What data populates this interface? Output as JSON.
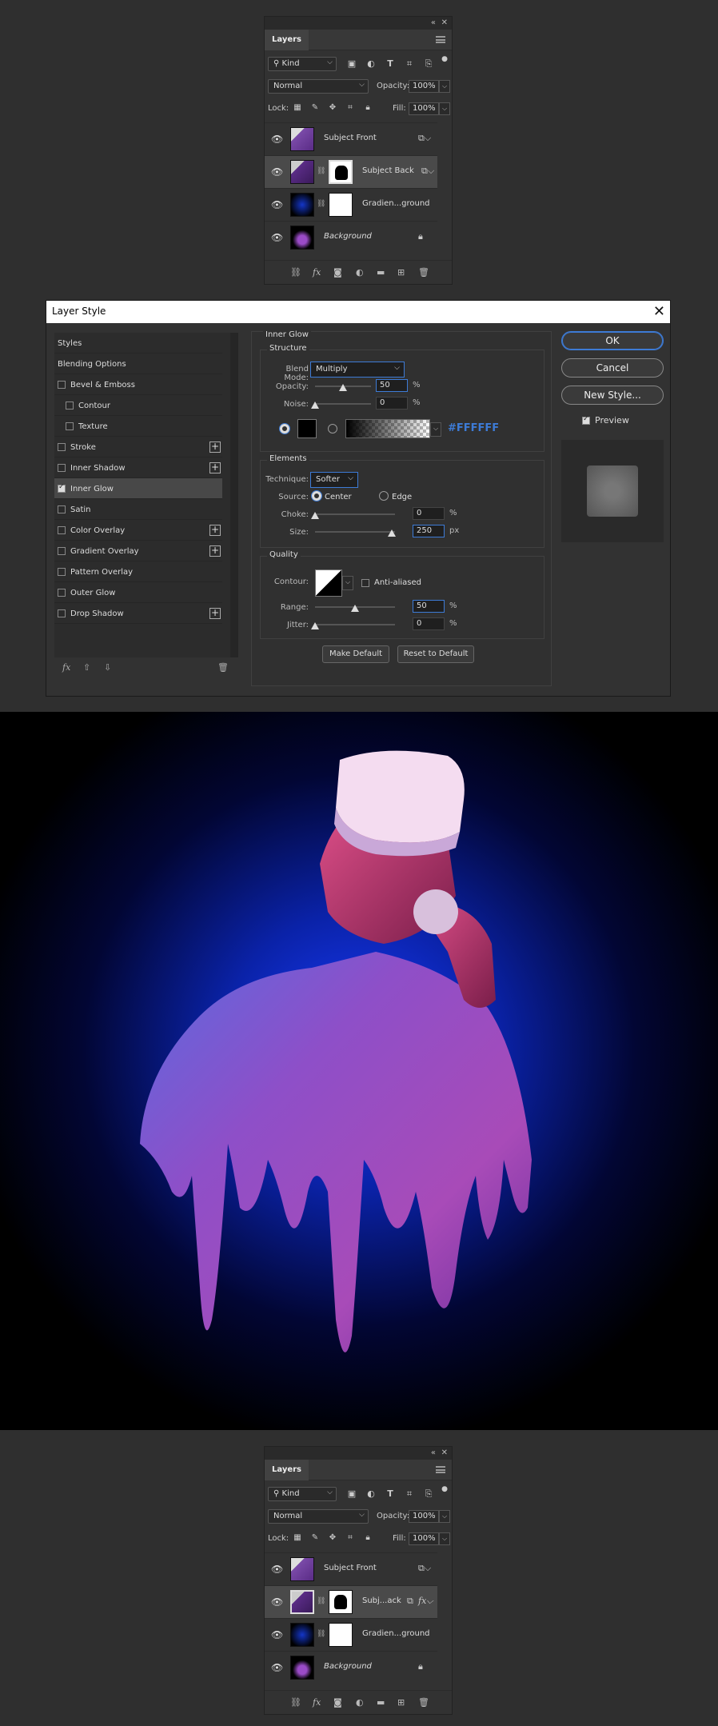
{
  "layers_panel": {
    "tab_label": "Layers",
    "filter_kind": "Kind",
    "blend_mode": "Normal",
    "opacity_label": "Opacity:",
    "opacity_value": "100%",
    "lock_label": "Lock:",
    "fill_label": "Fill:",
    "fill_value": "100%"
  },
  "layers_top": [
    {
      "name": "Subject Front",
      "italic": false
    },
    {
      "name": "Subject Back",
      "italic": false
    },
    {
      "name": "Gradien...ground",
      "italic": false
    },
    {
      "name": "Background",
      "italic": true
    }
  ],
  "layers_bottom": [
    {
      "name": "Subject Front",
      "italic": false
    },
    {
      "name": "Subj...ack",
      "italic": false
    },
    {
      "name": "Gradien...ground",
      "italic": false
    },
    {
      "name": "Background",
      "italic": true
    }
  ],
  "dialog": {
    "title": "Layer Style",
    "styles_header": "Styles",
    "blending_options": "Blending Options",
    "list": [
      {
        "label": "Bevel & Emboss",
        "checked": false,
        "indent": false,
        "plus": false
      },
      {
        "label": "Contour",
        "checked": false,
        "indent": true,
        "plus": false
      },
      {
        "label": "Texture",
        "checked": false,
        "indent": true,
        "plus": false
      },
      {
        "label": "Stroke",
        "checked": false,
        "indent": false,
        "plus": true
      },
      {
        "label": "Inner Shadow",
        "checked": false,
        "indent": false,
        "plus": true
      },
      {
        "label": "Inner Glow",
        "checked": true,
        "indent": false,
        "plus": false,
        "active": true
      },
      {
        "label": "Satin",
        "checked": false,
        "indent": false,
        "plus": false
      },
      {
        "label": "Color Overlay",
        "checked": false,
        "indent": false,
        "plus": true
      },
      {
        "label": "Gradient Overlay",
        "checked": false,
        "indent": false,
        "plus": true
      },
      {
        "label": "Pattern Overlay",
        "checked": false,
        "indent": false,
        "plus": false
      },
      {
        "label": "Outer Glow",
        "checked": false,
        "indent": false,
        "plus": false
      },
      {
        "label": "Drop Shadow",
        "checked": false,
        "indent": false,
        "plus": true
      }
    ],
    "section_title": "Inner Glow",
    "structure_title": "Structure",
    "blend_mode_label": "Blend Mode:",
    "blend_mode_value": "Multiply",
    "opacity_label": "Opacity:",
    "opacity_value": "50",
    "noise_label": "Noise:",
    "noise_value": "0",
    "color_hex": "#FFFFFF",
    "elements_title": "Elements",
    "technique_label": "Technique:",
    "technique_value": "Softer",
    "source_label": "Source:",
    "source_center": "Center",
    "source_edge": "Edge",
    "choke_label": "Choke:",
    "choke_value": "0",
    "size_label": "Size:",
    "size_value": "250",
    "quality_title": "Quality",
    "contour_label": "Contour:",
    "anti_aliased_label": "Anti-aliased",
    "range_label": "Range:",
    "range_value": "50",
    "jitter_label": "Jitter:",
    "jitter_value": "0",
    "pct": "%",
    "px": "px",
    "make_default": "Make Default",
    "reset_default": "Reset to Default",
    "ok": "OK",
    "cancel": "Cancel",
    "new_style": "New Style...",
    "preview_label": "Preview",
    "accent": "#3d7bd6"
  },
  "artwork": {
    "subject": "person wearing VR headset and hoodie",
    "background_color": "#000000",
    "glow_color": "#0a2bd0",
    "hoodie_color": "#9a4bc7"
  }
}
